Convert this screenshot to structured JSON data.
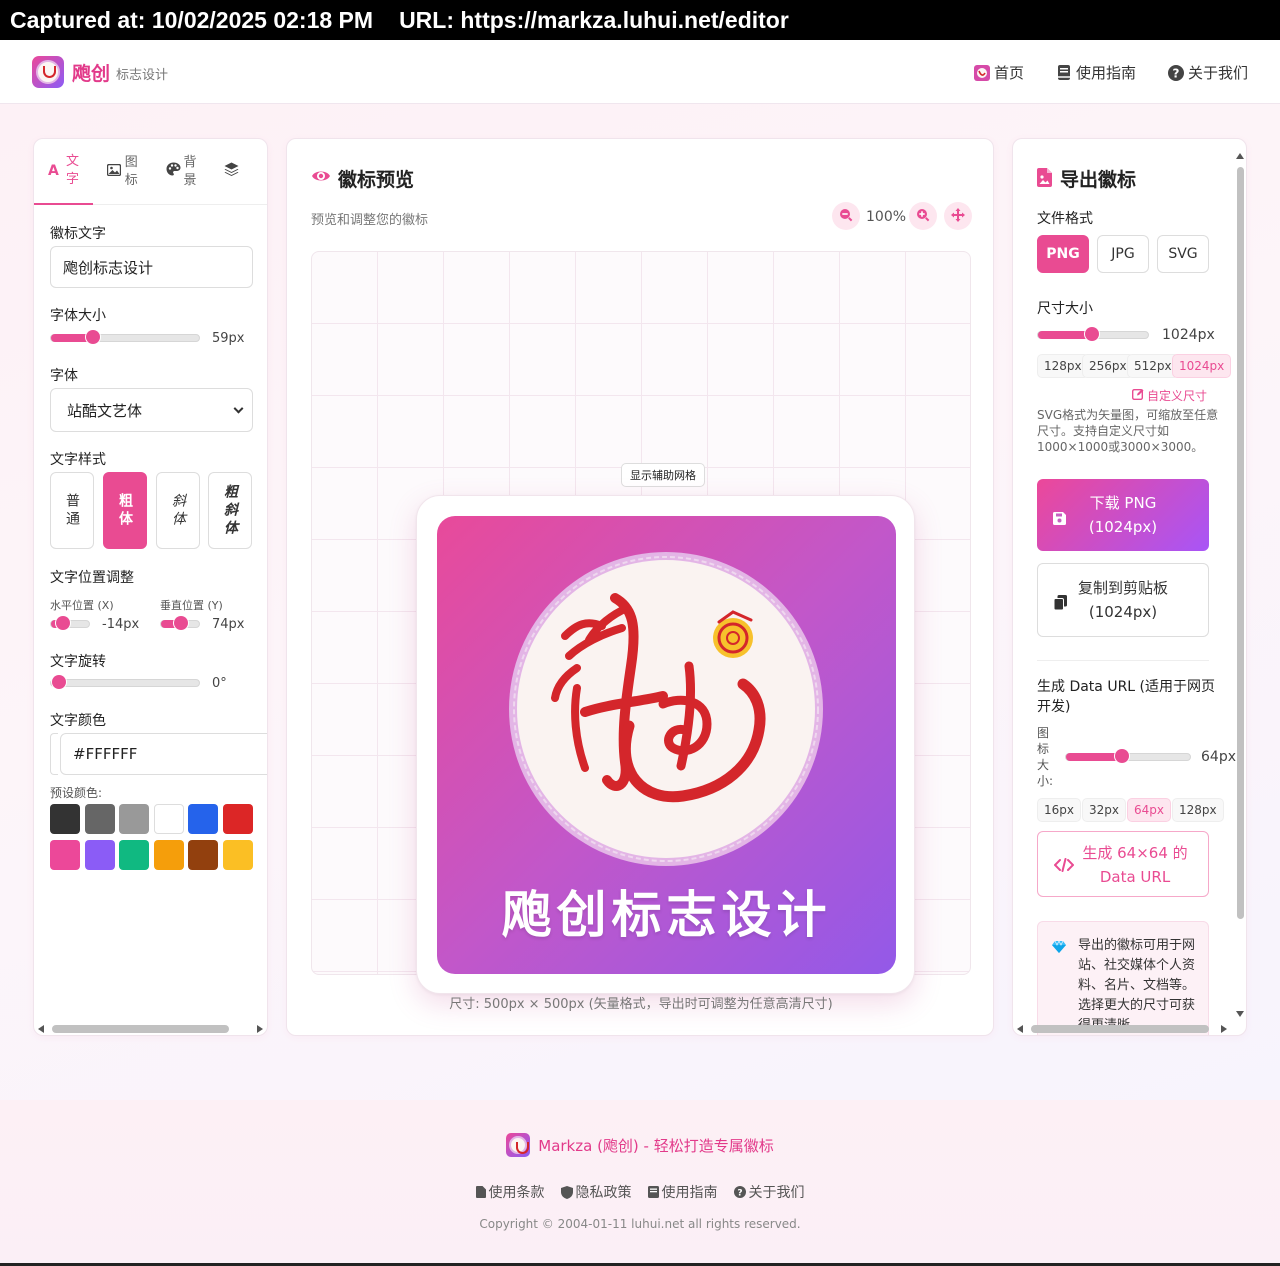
{
  "capture": {
    "captured_at": "Captured at: 10/02/2025 02:18 PM",
    "url": "URL: https://markza.luhui.net/editor"
  },
  "nav": {
    "brand": "飑创",
    "brand_sub": "标志设计",
    "links": [
      "首页",
      "使用指南",
      "关于我们"
    ]
  },
  "left_panel": {
    "tabs": [
      {
        "icon": "text-icon",
        "label": "文字"
      },
      {
        "icon": "image-icon",
        "label": "图标"
      },
      {
        "icon": "palette-icon",
        "label": "背景"
      },
      {
        "icon": "layers-icon",
        "label": ""
      }
    ],
    "logo_text_label": "徽标文字",
    "logo_text_value": "飑创标志设计",
    "font_size_label": "字体大小",
    "font_size_value": "59px",
    "font_size_level": 0.28,
    "font_label": "字体",
    "font_value": "站酷文艺体",
    "style_label": "文字样式",
    "styles": [
      "普通",
      "粗体",
      "斜体",
      "粗斜体"
    ],
    "style_active": "粗体",
    "position_label": "文字位置调整",
    "pos_x_label": "水平位置 (X)",
    "pos_x_value": "-14px",
    "pos_y_label": "垂直位置 (Y)",
    "pos_y_value": "74px",
    "rotation_label": "文字旋转",
    "rotation_value": "0°",
    "color_label": "文字颜色",
    "color_value": "#FFFFFF",
    "preset_label": "预设颜色:",
    "preset_colors": [
      "#333333",
      "#666666",
      "#999999",
      "#FFFFFF",
      "#2563EB",
      "#DC2626",
      "#EC4899",
      "#8B5CF6",
      "#10B981",
      "#F59E0B",
      "#92400E",
      "#FBBF24"
    ]
  },
  "preview": {
    "title": "徽标预览",
    "subtitle": "预览和调整您的徽标",
    "zoom": "100%",
    "grid_button": "显示辅助网格",
    "logo_text": "飑创标志设计",
    "size_note": "尺寸: 500px × 500px (矢量格式，导出时可调整为任意高清尺寸)",
    "colors": {
      "gradient_start": "#E84A9A",
      "gradient_end": "#9359E8",
      "seal_red": "#D4262B"
    }
  },
  "export": {
    "title": "导出徽标",
    "format_label": "文件格式",
    "formats": [
      "PNG",
      "JPG",
      "SVG"
    ],
    "format_active": "PNG",
    "size_label": "尺寸大小",
    "size_value": "1024px",
    "size_presets": [
      "128px",
      "256px",
      "512px",
      "1024px"
    ],
    "custom_size": "自定义尺寸",
    "svg_note": "SVG格式为矢量图，可缩放至任意尺寸。支持自定义尺寸如1000×1000或3000×3000。",
    "download_label": "下载 PNG",
    "download_sub": "(1024px)",
    "copy_label": "复制到剪贴板",
    "copy_sub": "(1024px)",
    "dataurl_label": "生成 Data URL (适用于网页开发)",
    "icon_size_label": "图标大小:",
    "icon_size_value": "64px",
    "icon_presets": [
      "16px",
      "32px",
      "64px",
      "128px"
    ],
    "generate_label": "生成 64×64 的",
    "generate_sub": "Data URL",
    "tip": "导出的徽标可用于网站、社交媒体个人资料、名片、文档等。选择更大的尺寸可获得更清晰"
  },
  "footer": {
    "title": "Markza (飑创) - 轻松打造专属徽标",
    "links": [
      "使用条款",
      "隐私政策",
      "使用指南",
      "关于我们"
    ],
    "copyright": "Copyright © 2004-01-11 luhui.net all rights reserved."
  },
  "accent_color": "#E94B92"
}
